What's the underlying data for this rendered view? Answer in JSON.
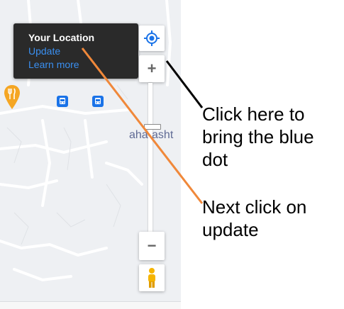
{
  "tooltip": {
    "title": "Your Location",
    "update_link": "Update",
    "learn_more_link": "Learn more"
  },
  "map": {
    "label": "aharasht"
  },
  "controls": {
    "zoom_in_label": "+",
    "zoom_out_label": "−"
  },
  "annotations": {
    "first": "Click here to bring the blue dot",
    "second": "Next click on update"
  },
  "icons": {
    "my_location": "my-location-icon",
    "pegman": "pegman-icon",
    "bus_stop": "bus-stop-icon",
    "restaurant": "restaurant-pin-icon"
  },
  "colors": {
    "accent_blue": "#1a73e8",
    "link_blue": "#3a8ff0",
    "arrow_orange": "#f0883a",
    "arrow_black": "#000000",
    "pegman_yellow": "#f5b400"
  }
}
